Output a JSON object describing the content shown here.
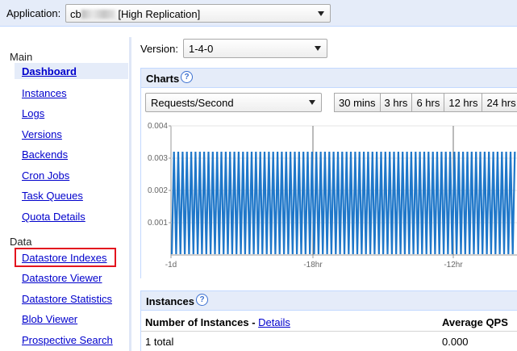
{
  "topbar": {
    "app_label": "Application:",
    "app_prefix": "cb",
    "app_suffix": "[High Replication]"
  },
  "sidebar": {
    "main_label": "Main",
    "data_label": "Data",
    "main_items": [
      "Dashboard",
      "Instances",
      "Logs",
      "Versions",
      "Backends",
      "Cron Jobs",
      "Task Queues",
      "Quota Details"
    ],
    "data_items": [
      "Datastore Indexes",
      "Datastore Viewer",
      "Datastore Statistics",
      "Blob Viewer",
      "Prospective Search"
    ],
    "selected": "Dashboard",
    "highlighted": "Datastore Indexes"
  },
  "version": {
    "label": "Version:",
    "value": "1-4-0"
  },
  "charts": {
    "title": "Charts",
    "help_icon": "question-circle-icon",
    "metric": "Requests/Second",
    "ranges": [
      "30 mins",
      "3 hrs",
      "6 hrs",
      "12 hrs",
      "24 hrs"
    ]
  },
  "chart_data": {
    "type": "line",
    "yticks": [
      "0.004",
      "0.003",
      "0.002",
      "0.001"
    ],
    "xticks": [
      "-1d",
      "-18hr",
      "-12hr"
    ],
    "ylim": [
      0,
      0.004
    ],
    "peak_value": 0.0032,
    "pattern": "periodic spikes between 0 and 0.0032",
    "color": "#1f77c9"
  },
  "instances": {
    "title": "Instances",
    "col_number": "Number of Instances",
    "col_sep": " - ",
    "details_link": "Details",
    "col_qps": "Average QPS",
    "row_total": "1 total",
    "row_qps": "0.000"
  }
}
